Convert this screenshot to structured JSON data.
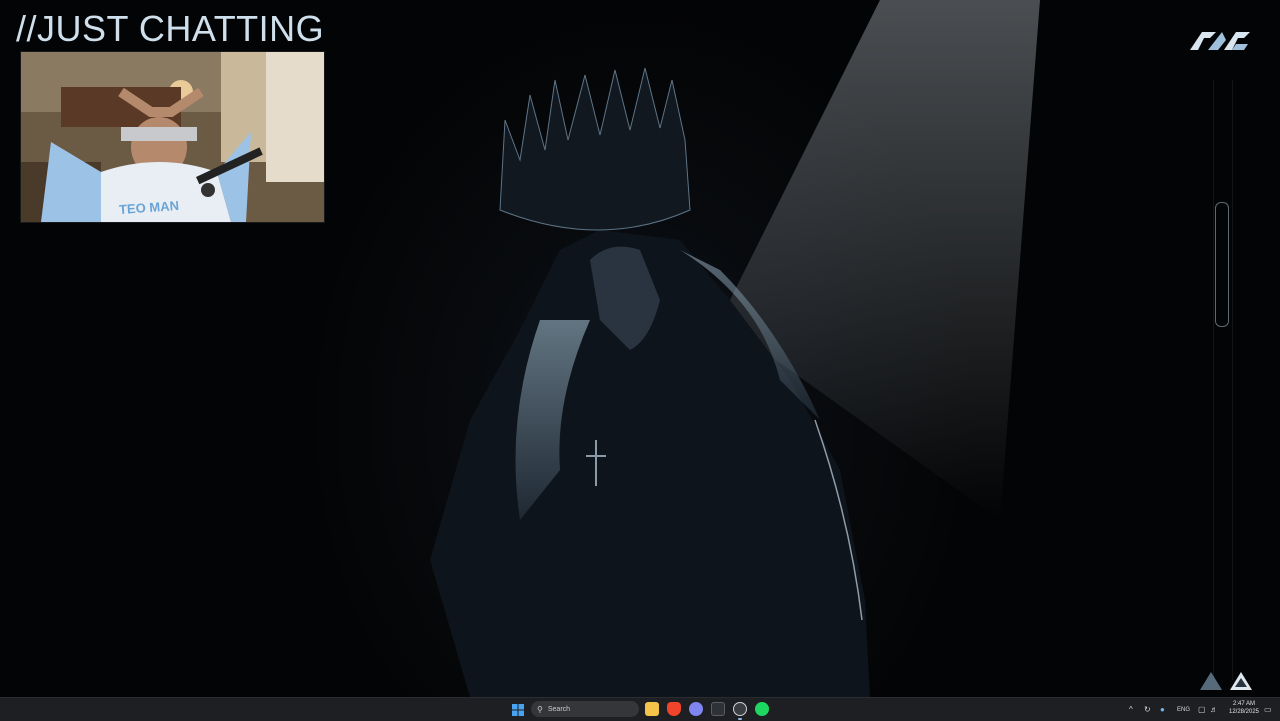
{
  "overlay": {
    "title": "//JUST CHATTING"
  },
  "webcam": {
    "shirt_text": "TEO MAN"
  },
  "logo": {
    "icon": "stream-logo-icon"
  },
  "taskbar": {
    "search_placeholder": "Search",
    "apps": [
      "windows-start-icon",
      "file-explorer-icon",
      "brave-browser-icon",
      "discord-icon",
      "terminal-icon",
      "obs-icon",
      "spotify-icon"
    ],
    "tray": {
      "chevron": "^",
      "language": "ENG"
    },
    "clock": {
      "time": "2:47 AM",
      "date": "12/28/2025"
    }
  },
  "colors": {
    "accent_blue": "#8fb8e6",
    "title_text": "#cfe0ec",
    "taskbar_bg": "#1d1f22"
  }
}
